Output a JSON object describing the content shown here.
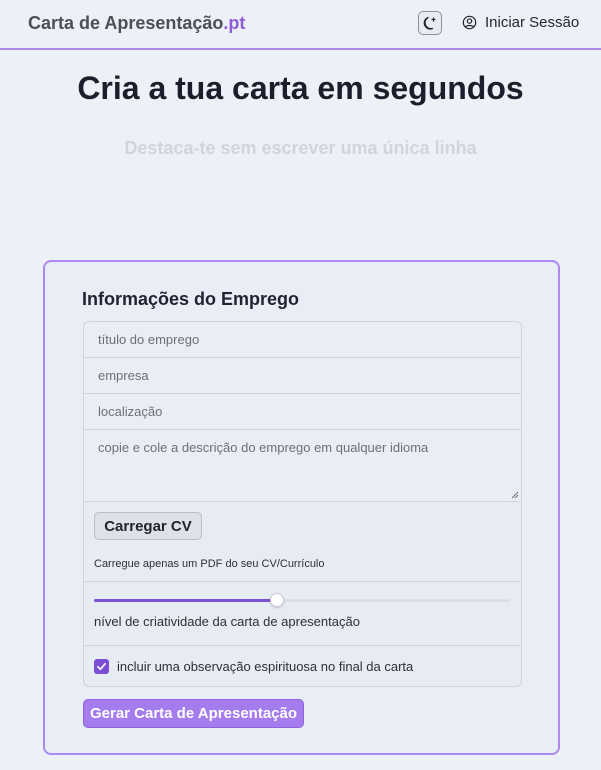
{
  "header": {
    "logo_main": "Carta de Apresentação",
    "logo_tld": ".pt",
    "theme_toggle_icon": "moon-stars-icon",
    "login_icon": "user-circle-icon",
    "login_label": "Iniciar Sessão"
  },
  "hero": {
    "title": "Cria a tua carta em segundos",
    "subtitle": "Destaca-te sem escrever uma única linha"
  },
  "form": {
    "title": "Informações do Emprego",
    "job_title_placeholder": "título do emprego",
    "company_placeholder": "empresa",
    "location_placeholder": "localização",
    "description_placeholder": "copie e cole a descrição do emprego em qualquer idioma",
    "upload_label": "Carregar CV",
    "upload_hint": "Carregue apenas um PDF do seu CV/Currículo",
    "creativity_label": "nível de criatividade da carta de apresentação",
    "creativity_value": 0.44,
    "witty_note_label": "incluir uma observação espirituosa no final da carta",
    "witty_note_checked": true,
    "submit_label": "Gerar Carta de Apresentação"
  },
  "colors": {
    "accent": "#8f5cd8",
    "button": "#a57ced",
    "checkbox": "#7a4fd6"
  }
}
